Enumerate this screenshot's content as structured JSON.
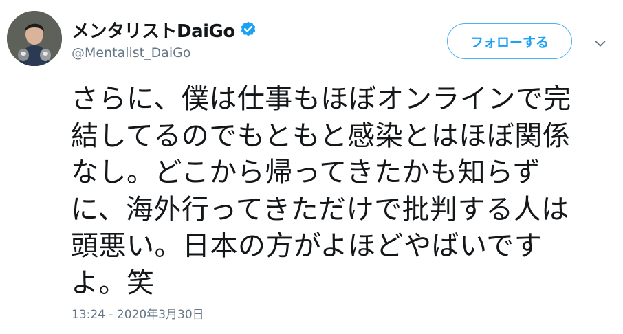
{
  "user": {
    "display_name": "メンタリストDaiGo",
    "handle": "@Mentalist_DaiGo",
    "verified": true,
    "avatar_icon": "profile-photo"
  },
  "actions": {
    "follow_label": "フォローする",
    "caret_icon": "chevron-down-icon"
  },
  "tweet": {
    "lines": [
      "さらに、僕は仕事もほぼオンラインで完",
      "結してるのでもともと感染とはほぼ関係",
      "なし。どこから帰ってきたかも知らず",
      "に、海外行ってきただけで批判する人は",
      "頭悪い。日本の方がよほどやばいです",
      "よ。笑"
    ],
    "timestamp": "13:24 - 2020年3月30日"
  },
  "colors": {
    "accent": "#1da1f2",
    "text": "#14171a",
    "muted": "#657786"
  }
}
